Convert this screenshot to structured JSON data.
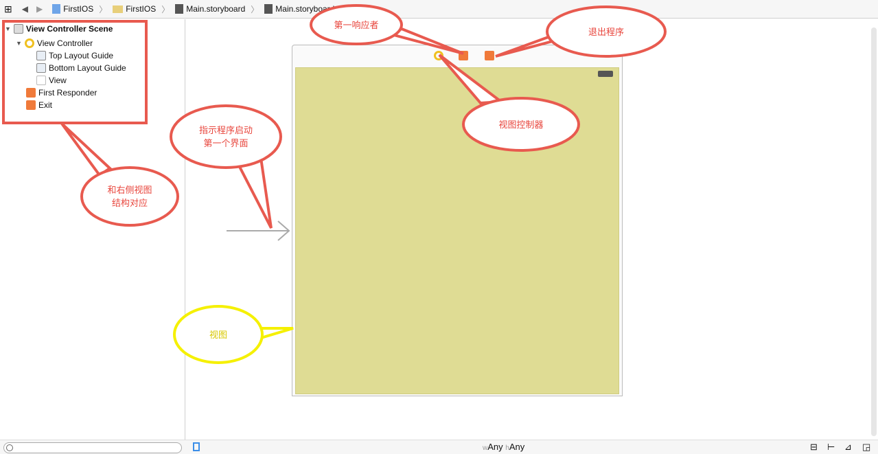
{
  "breadcrumb": [
    "FirstIOS",
    "FirstIOS",
    "Main.storyboard",
    "Main.storyboard (Base)"
  ],
  "outline": {
    "scene": "View Controller Scene",
    "vc": "View Controller",
    "top": "Top Layout Guide",
    "bottom": "Bottom Layout Guide",
    "view": "View",
    "responder": "First Responder",
    "exit": "Exit"
  },
  "size_class": {
    "w": "w",
    "w_val": "Any",
    "h": "h",
    "h_val": "Any"
  },
  "annotations": {
    "responder": "第一响应者",
    "exit": "退出程序",
    "vc": "视图控制器",
    "entry": "指示程序启动\n第一个界面",
    "outline": "和右侧视图\n结构对应",
    "view": "视图"
  },
  "colors": {
    "callout": "#e85a4f",
    "view_callout": "#f5f000",
    "view_bg": "#dfdc94"
  }
}
